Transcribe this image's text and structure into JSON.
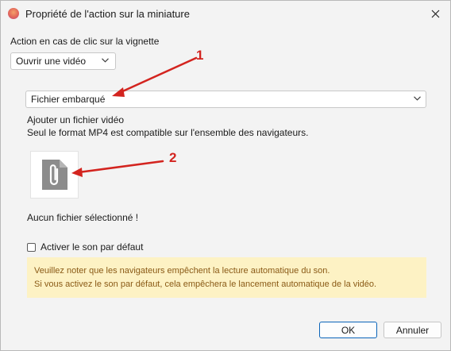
{
  "window": {
    "title": "Propriété de l'action sur la miniature",
    "app_icon": "app-logo-icon",
    "close_icon": "close-icon"
  },
  "click_action": {
    "label": "Action en cas de clic sur la vignette",
    "selected": "Ouvrir une vidéo"
  },
  "source": {
    "selected": "Fichier embarqué"
  },
  "add_file": {
    "heading": "Ajouter un fichier vidéo",
    "hint": "Seul le format MP4 est compatible sur l'ensemble des navigateurs.",
    "icon": "paperclip-file-icon",
    "status": "Aucun fichier sélectionné !"
  },
  "sound": {
    "label": "Activer le son par défaut",
    "checked": false
  },
  "notice": {
    "line1": "Veuillez noter que les navigateurs empêchent la lecture automatique du son.",
    "line2": "Si vous activez le son par défaut, cela empêchera le lancement automatique de la vidéo.",
    "background": "#fdf2c4",
    "text_color": "#8a5a16"
  },
  "buttons": {
    "ok": "OK",
    "cancel": "Annuler"
  },
  "annotations": {
    "marker1": "1",
    "marker2": "2",
    "color": "#d3241f"
  }
}
